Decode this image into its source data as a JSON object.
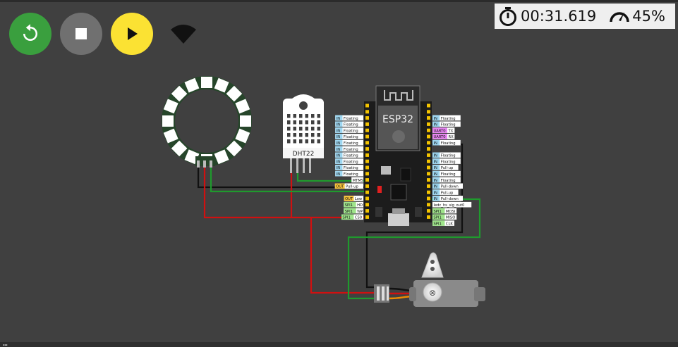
{
  "toolbar": {
    "restart_icon": "restart-icon",
    "stop_icon": "stop-icon",
    "play_icon": "play-icon",
    "wifi_icon": "wifi-icon",
    "colors": {
      "restart": "#3a9f3e",
      "stop": "#707070",
      "play": "#fbe233"
    }
  },
  "status": {
    "time": "00:31.619",
    "speed": "45%"
  },
  "parts": {
    "dht22_label": "DHT22",
    "esp32_label": "ESP32",
    "esp32_left_pins": [
      {
        "tag": "IN",
        "mode": "Floating"
      },
      {
        "tag": "IN",
        "mode": "Floating"
      },
      {
        "tag": "IN",
        "mode": "Floating"
      },
      {
        "tag": "IN",
        "mode": "Floating"
      },
      {
        "tag": "IN",
        "mode": "Floating"
      },
      {
        "tag": "IN",
        "mode": "Floating"
      },
      {
        "tag": "IN",
        "mode": "Floating"
      },
      {
        "tag": "IN",
        "mode": "Floating"
      },
      {
        "tag": "IN",
        "mode": "Floating"
      },
      {
        "tag": "IN",
        "mode": "Floating"
      },
      {
        "tag": "",
        "mode": "MTMS"
      },
      {
        "tag": "OUT",
        "mode": "Pull-up"
      },
      {
        "tag": "",
        "mode": ""
      },
      {
        "tag": "OUT",
        "mode": "Low"
      },
      {
        "tag": "SPI1",
        "mode": "HD"
      },
      {
        "tag": "SPI1",
        "mode": "WP"
      },
      {
        "tag": "SPI1",
        "mode": "CS0"
      }
    ],
    "esp32_right_pins": [
      {
        "tag": "IN",
        "mode": "Floating"
      },
      {
        "tag": "IN",
        "mode": "Floating"
      },
      {
        "tag": "UART0",
        "mode": "TX"
      },
      {
        "tag": "UART0",
        "mode": "RX"
      },
      {
        "tag": "IN",
        "mode": "Floating"
      },
      {
        "tag": "",
        "mode": ""
      },
      {
        "tag": "IN",
        "mode": "Floating"
      },
      {
        "tag": "IN",
        "mode": "Floating"
      },
      {
        "tag": "IN",
        "mode": "Pull-up"
      },
      {
        "tag": "IN",
        "mode": "Floating"
      },
      {
        "tag": "IN",
        "mode": "Floating"
      },
      {
        "tag": "IN",
        "mode": "Pull-down"
      },
      {
        "tag": "IN",
        "mode": "Pull-up"
      },
      {
        "tag": "IN",
        "mode": "Pull-down"
      },
      {
        "tag": "",
        "mode": "ledc_hs_sig_out0"
      },
      {
        "tag": "SPI1",
        "mode": "MOSI"
      },
      {
        "tag": "SPI1",
        "mode": "MISO"
      },
      {
        "tag": "SPI1",
        "mode": "CLK"
      }
    ]
  },
  "serial": {
    "line": "…"
  }
}
